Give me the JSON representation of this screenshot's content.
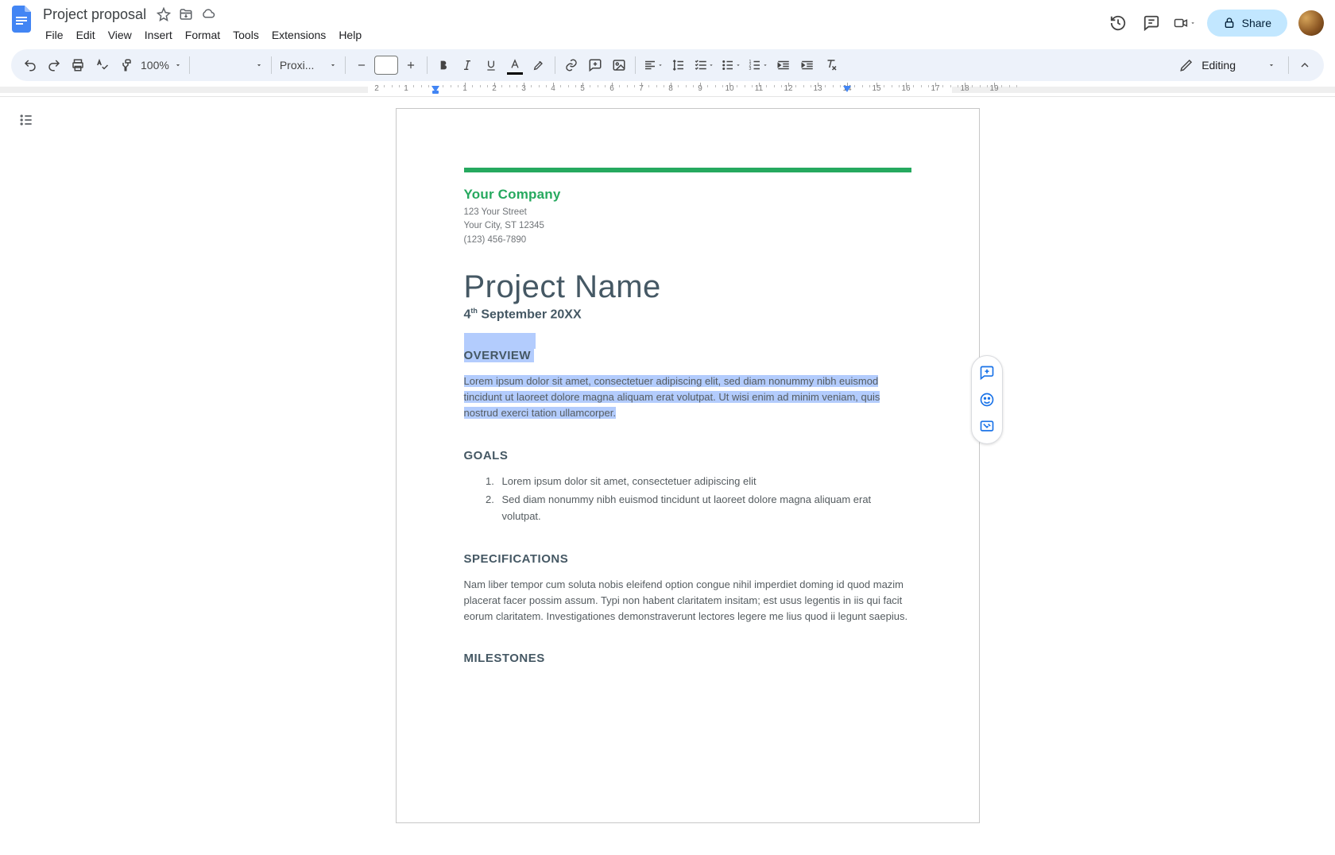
{
  "header": {
    "doc_title": "Project proposal",
    "menus": [
      "File",
      "Edit",
      "View",
      "Insert",
      "Format",
      "Tools",
      "Extensions",
      "Help"
    ],
    "share_label": "Share"
  },
  "toolbar": {
    "zoom": "100%",
    "style": "",
    "font": "Proxi...",
    "fontsize": "",
    "mode_label": "Editing"
  },
  "ruler": {
    "numbers": [
      "2",
      "1",
      "1",
      "2",
      "3",
      "4",
      "5",
      "6",
      "7",
      "8",
      "9",
      "10",
      "11",
      "12",
      "13",
      "14",
      "15",
      "16",
      "17",
      "18",
      "19"
    ]
  },
  "document": {
    "company": "Your Company",
    "address_line1": "123 Your Street",
    "address_line2": "Your City, ST 12345",
    "phone": "(123) 456-7890",
    "project_title": "Project Name",
    "date_day": "4",
    "date_ord": "th",
    "date_rest": " September 20XX",
    "overview_heading": "OVERVIEW",
    "overview_body": "Lorem ipsum dolor sit amet, consectetuer adipiscing elit, sed diam nonummy nibh euismod tincidunt ut laoreet dolore magna aliquam erat volutpat. Ut wisi enim ad minim veniam, quis nostrud exerci tation ullamcorper.",
    "goals_heading": "GOALS",
    "goals": [
      "Lorem ipsum dolor sit amet, consectetuer adipiscing elit",
      "Sed diam nonummy nibh euismod tincidunt ut laoreet dolore magna aliquam erat volutpat."
    ],
    "spec_heading": "SPECIFICATIONS",
    "spec_body": "Nam liber tempor cum soluta nobis eleifend option congue nihil imperdiet doming id quod mazim placerat facer possim assum. Typi non habent claritatem insitam; est usus legentis in iis qui facit eorum claritatem. Investigationes demonstraverunt lectores legere me lius quod ii legunt saepius.",
    "milestones_heading": "MILESTONES"
  }
}
